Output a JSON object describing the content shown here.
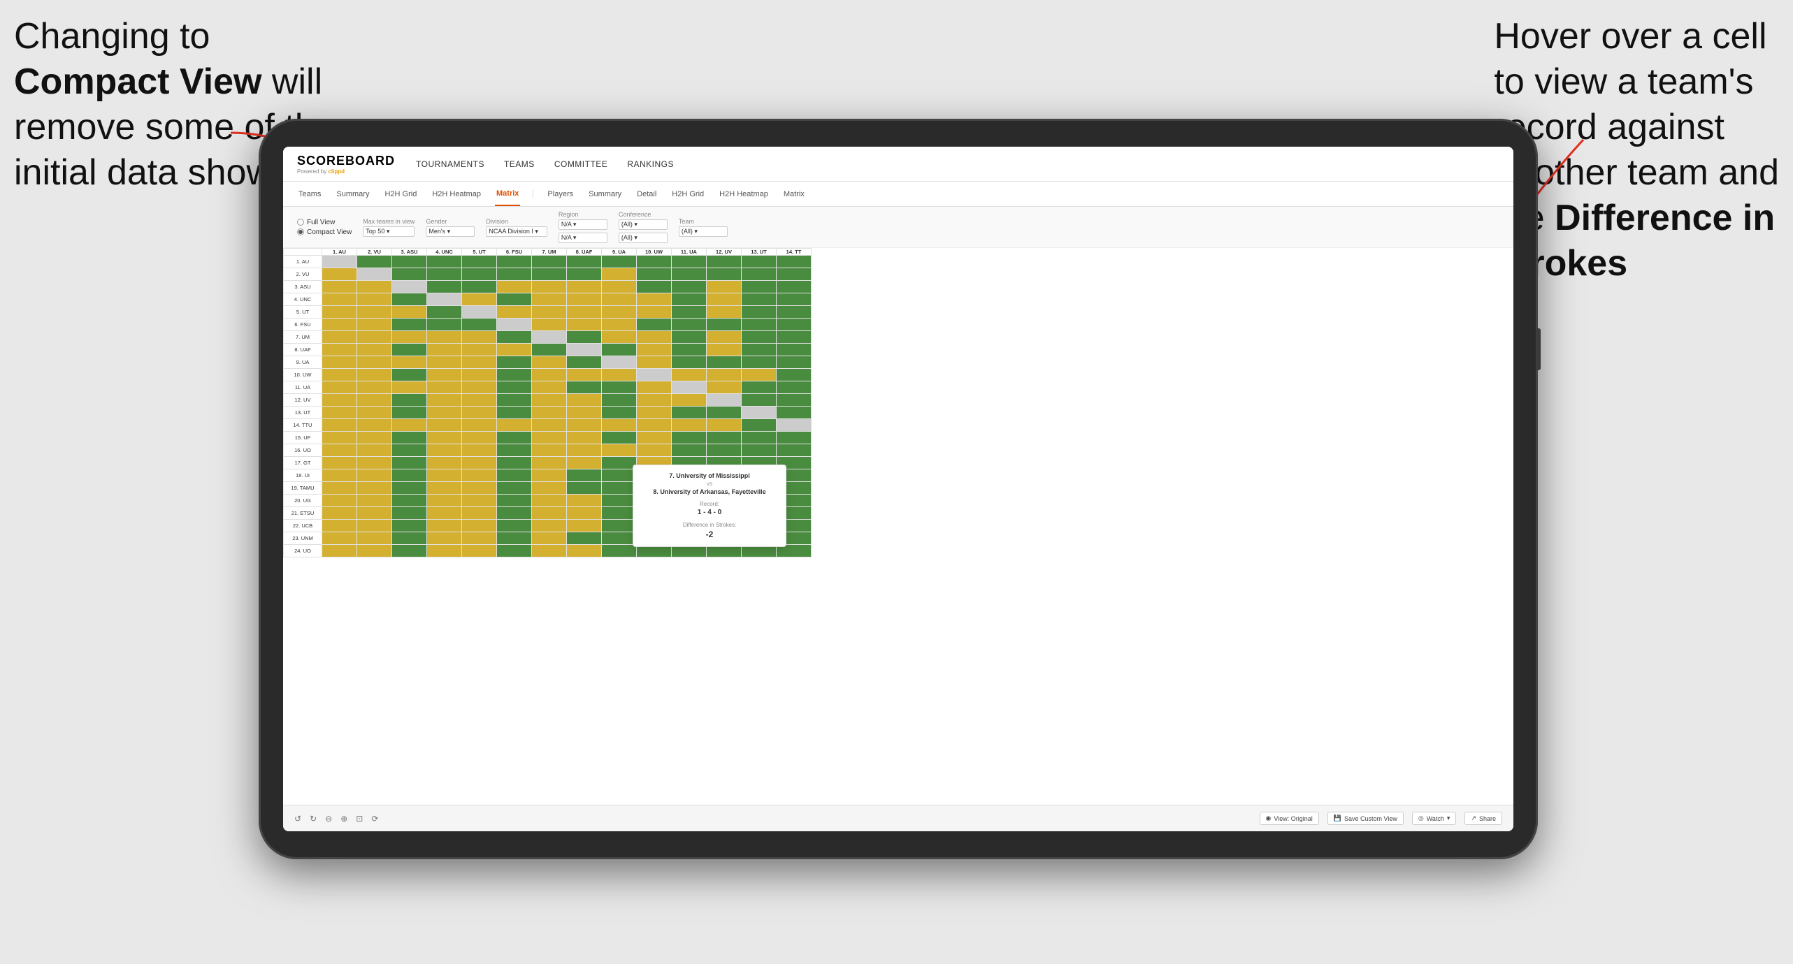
{
  "annotations": {
    "left": {
      "line1": "Changing to",
      "line2_bold": "Compact View",
      "line2_rest": " will",
      "line3": "remove some of the",
      "line4": "initial data shown"
    },
    "right": {
      "line1": "Hover over a cell",
      "line2": "to view a team's",
      "line3": "record against",
      "line4": "another team and",
      "line5_pre": "the ",
      "line5_bold": "Difference in",
      "line6_bold": "Strokes"
    }
  },
  "navbar": {
    "logo": "SCOREBOARD",
    "logo_sub": "Powered by clippd",
    "nav_items": [
      "TOURNAMENTS",
      "TEAMS",
      "COMMITTEE",
      "RANKINGS"
    ]
  },
  "sub_tabs_left": [
    "Teams",
    "Summary",
    "H2H Grid",
    "H2H Heatmap",
    "Matrix"
  ],
  "sub_tabs_right_label": "Players",
  "sub_tabs_right": [
    "Summary",
    "Detail",
    "H2H Grid",
    "H2H Heatmap",
    "Matrix"
  ],
  "active_tab": "Matrix",
  "controls": {
    "view_options": [
      "Full View",
      "Compact View"
    ],
    "selected_view": "Compact View",
    "max_teams": {
      "label": "Max teams in view",
      "value": "Top 50"
    },
    "gender": {
      "label": "Gender",
      "value": "Men's"
    },
    "division": {
      "label": "Division",
      "value": "NCAA Division I"
    },
    "region": {
      "label": "Region",
      "value": "N/A",
      "value2": "N/A"
    },
    "conference": {
      "label": "Conference",
      "value": "(All)",
      "value2": "(All)"
    },
    "team": {
      "label": "Team",
      "value": "(All)"
    }
  },
  "col_headers": [
    "1. AU",
    "2. VU",
    "3. ASU",
    "4. UNC",
    "5. UT",
    "6. FSU",
    "7. UM",
    "8. UAF",
    "9. UA",
    "10. UW",
    "11. UA",
    "12. UV",
    "13. UT",
    "14. TT"
  ],
  "row_labels": [
    "1. AU",
    "2. VU",
    "3. ASU",
    "4. UNC",
    "5. UT",
    "6. FSU",
    "7. UM",
    "8. UAF",
    "9. UA",
    "10. UW",
    "11. UA",
    "12. UV",
    "13. UT",
    "14. TTU",
    "15. UF",
    "16. UO",
    "17. GT",
    "18. UI",
    "19. TAMU",
    "20. UG",
    "21. ETSU",
    "22. UCB",
    "23. UNM",
    "24. UO"
  ],
  "tooltip": {
    "team1": "7. University of Mississippi",
    "vs": "vs",
    "team2": "8. University of Arkansas, Fayetteville",
    "record_label": "Record:",
    "record_value": "1 - 4 - 0",
    "strokes_label": "Difference in Strokes:",
    "strokes_value": "-2"
  },
  "toolbar": {
    "view_original": "View: Original",
    "save_custom": "Save Custom View",
    "watch": "Watch",
    "share": "Share"
  },
  "colors": {
    "dark_green": "#4a8c3f",
    "medium_green": "#5a9e50",
    "yellow": "#d4b030",
    "light_yellow": "#e8d070",
    "gray": "#c0c0c0",
    "white": "#ffffff",
    "accent_red": "#e03020"
  }
}
